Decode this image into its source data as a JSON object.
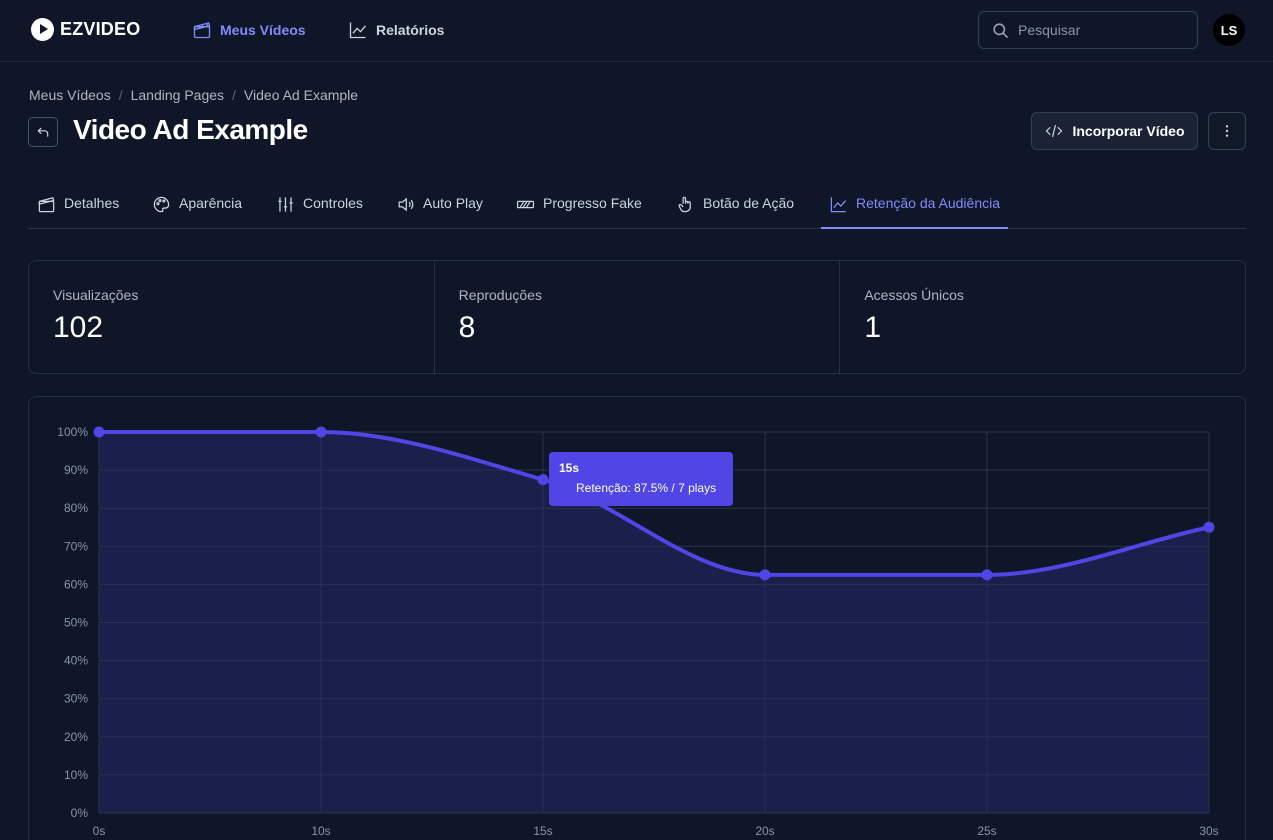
{
  "app": {
    "logo_text": "EZVIDEO"
  },
  "nav": {
    "videos_label": "Meus Vídeos",
    "reports_label": "Relatórios"
  },
  "search": {
    "placeholder": "Pesquisar"
  },
  "user": {
    "initials": "LS"
  },
  "breadcrumb": [
    "Meus Vídeos",
    "Landing Pages",
    "Video Ad Example"
  ],
  "breadcrumb_sep": "/",
  "page": {
    "title": "Video Ad Example",
    "embed_label": "Incorporar Vídeo"
  },
  "tabs": [
    {
      "label": "Detalhes",
      "icon": "clapperboard-icon"
    },
    {
      "label": "Aparência",
      "icon": "palette-icon"
    },
    {
      "label": "Controles",
      "icon": "sliders-icon"
    },
    {
      "label": "Auto Play",
      "icon": "volume-icon"
    },
    {
      "label": "Progresso Fake",
      "icon": "progress-bar-icon"
    },
    {
      "label": "Botão de Ação",
      "icon": "pointer-hand-icon"
    },
    {
      "label": "Retenção da Audiência",
      "icon": "line-chart-icon",
      "active": true
    }
  ],
  "stats": [
    {
      "label": "Visualizações",
      "value": "102"
    },
    {
      "label": "Reproduções",
      "value": "8"
    },
    {
      "label": "Acessos Únicos",
      "value": "1"
    }
  ],
  "colors": {
    "accent": "#818cf8",
    "line": "#4f46e5",
    "area": "#1b1f4b",
    "background": "#0f1628"
  },
  "chart_data": {
    "type": "area",
    "x": [
      "0s",
      "10s",
      "15s",
      "20s",
      "25s",
      "30s"
    ],
    "series": [
      {
        "values": [
          100,
          100,
          87.5,
          62.5,
          62.5,
          75
        ]
      }
    ],
    "y_ticks": [
      "0%",
      "10%",
      "20%",
      "30%",
      "40%",
      "50%",
      "60%",
      "70%",
      "80%",
      "90%",
      "100%"
    ],
    "ylim": [
      0,
      100
    ],
    "grid": true,
    "tooltip": {
      "title": "15s",
      "text": "Retenção: 87.5% / 7 plays"
    }
  }
}
